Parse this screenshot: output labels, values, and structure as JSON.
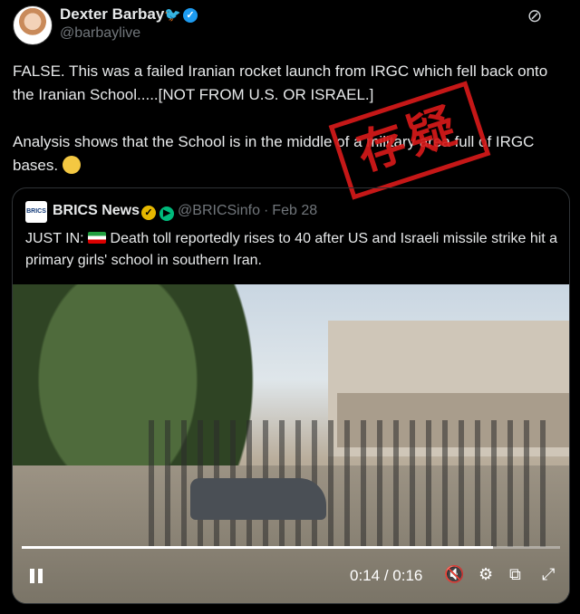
{
  "author": {
    "name": "Dexter Barbay",
    "handle": "@barbaylive",
    "bird_glyph": "🐦",
    "verified_glyph": "✓"
  },
  "tweet": {
    "line1": "FALSE. This was a failed Iranian rocket launch from IRGC which fell back onto the Iranian School.....[NOT FROM U.S. OR ISRAEL.]",
    "line2": "Analysis shows that the School is in the middle of a military area full of IRGC bases."
  },
  "stamp": {
    "text": "存疑",
    "color": "#d61a1a"
  },
  "quote": {
    "name": "BRICS News",
    "handle": "@BRICSinfo",
    "date": "Feb 28",
    "separator": "·",
    "avatar_text": "BRICS",
    "text_prefix": "JUST IN:",
    "text_body": "Death toll reportedly rises to 40 after US and Israeli missile strike hit a primary girls' school in southern Iran."
  },
  "video": {
    "current": "0:14",
    "duration": "0:16",
    "time_sep": " / ",
    "progress": 0.875,
    "icons": [
      "pause-icon",
      "volume-muted-icon",
      "settings-icon",
      "pip-icon",
      "fullscreen-icon"
    ]
  },
  "colors": {
    "accent": "#1d9bf0",
    "gold_badge": "#e6b800",
    "muted": "#71767b"
  }
}
